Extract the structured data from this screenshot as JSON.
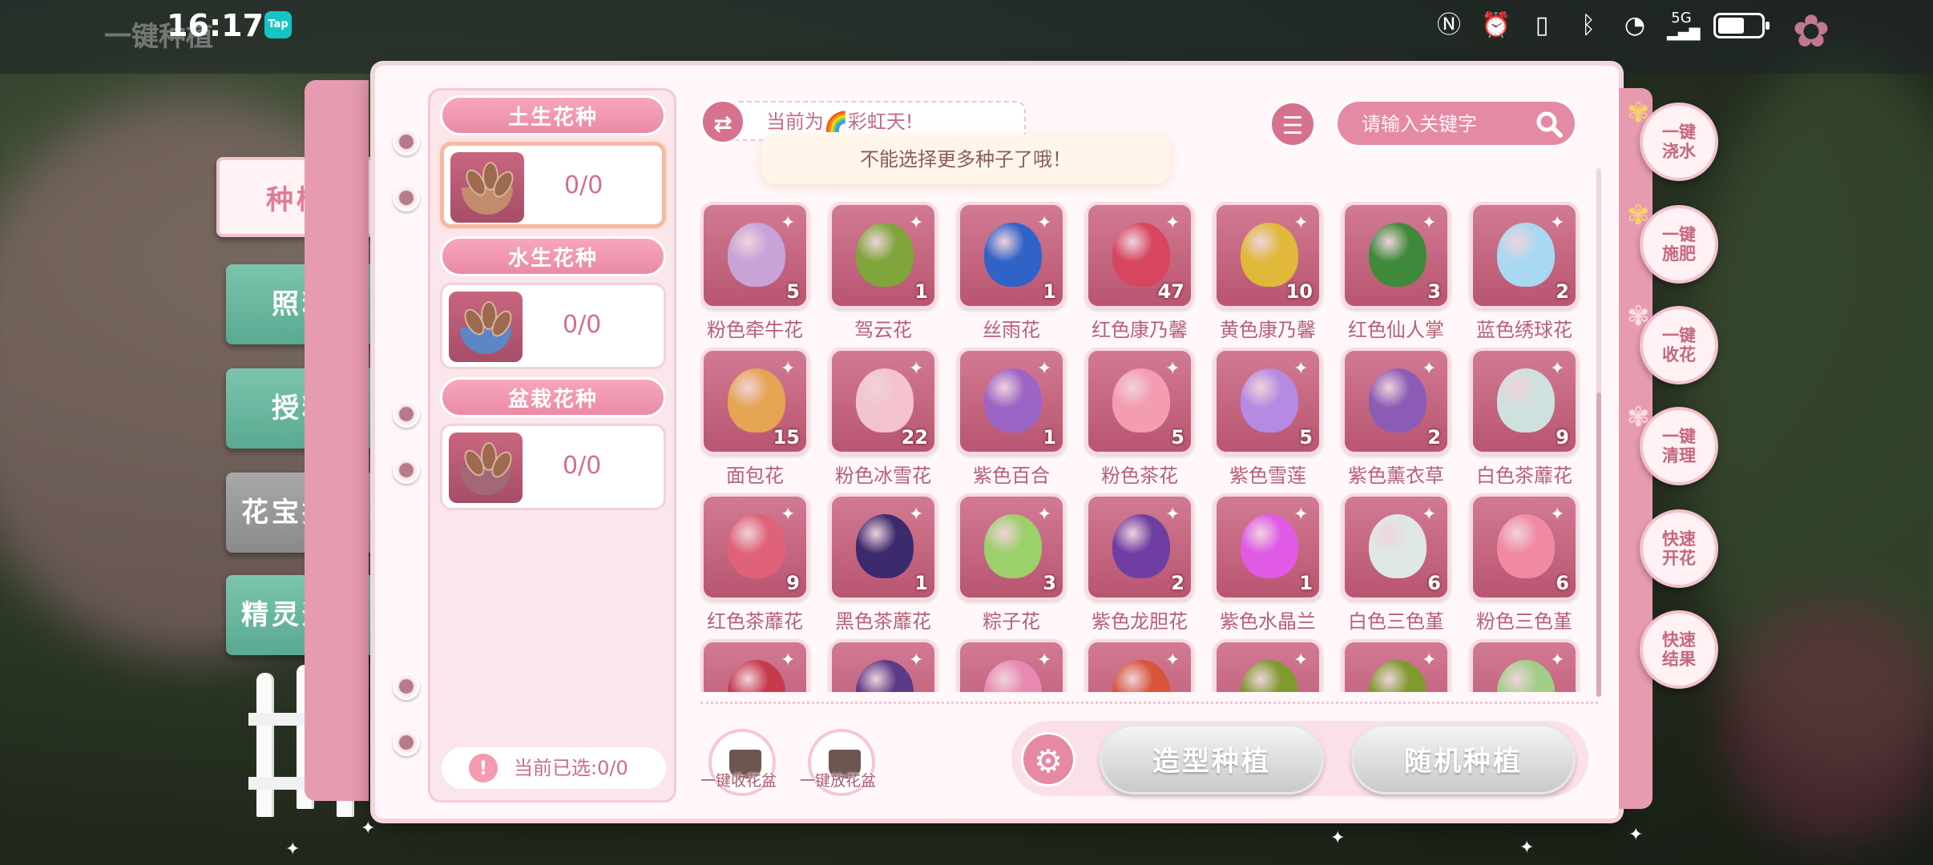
{
  "status_bar": {
    "bg_title": "一键种植",
    "time": "16:17",
    "tap_label": "Tap",
    "icons": [
      "nfc-icon",
      "alarm-icon",
      "vibrate-icon",
      "bluetooth-icon",
      "wifi-icon",
      "signal-5g-icon",
      "battery-icon"
    ],
    "signal_label": "5G"
  },
  "left_tabs": [
    {
      "label": "种植",
      "active": true
    },
    {
      "label": "照料"
    },
    {
      "label": "授粉"
    },
    {
      "label": "花宝技能"
    },
    {
      "label": "精灵道具"
    }
  ],
  "categories": [
    {
      "header": "土生花种",
      "count": "0/0",
      "type": "soil"
    },
    {
      "header": "水生花种",
      "count": "0/0",
      "type": "water"
    },
    {
      "header": "盆栽花种",
      "count": "0/0",
      "type": "pot"
    }
  ],
  "selected_label": "当前已选:0/0",
  "weather": {
    "prefix": "当前为",
    "emoji": "🌈",
    "name": "彩虹天!"
  },
  "toast": "不能选择更多种子了哦！",
  "search": {
    "placeholder": "请输入关键字"
  },
  "items": [
    {
      "name": "粉色牵牛花",
      "count": "5",
      "color": "#c7a3d8"
    },
    {
      "name": "驾云花",
      "count": "1",
      "color": "#7ea53a"
    },
    {
      "name": "丝雨花",
      "count": "1",
      "color": "#2f63c8"
    },
    {
      "name": "红色康乃馨",
      "count": "47",
      "color": "#d7455e"
    },
    {
      "name": "黄色康乃馨",
      "count": "10",
      "color": "#e0b93b"
    },
    {
      "name": "红色仙人掌",
      "count": "3",
      "color": "#3f8a3a"
    },
    {
      "name": "蓝色绣球花",
      "count": "2",
      "color": "#a9d8f2"
    },
    {
      "name": "面包花",
      "count": "15",
      "color": "#e5a552"
    },
    {
      "name": "粉色冰雪花",
      "count": "22",
      "color": "#f3c3cf"
    },
    {
      "name": "紫色百合",
      "count": "1",
      "color": "#9c64c6"
    },
    {
      "name": "粉色茶花",
      "count": "5",
      "color": "#f49cb1"
    },
    {
      "name": "紫色雪莲",
      "count": "5",
      "color": "#b68ae3"
    },
    {
      "name": "紫色薰衣草",
      "count": "2",
      "color": "#8a5cb6"
    },
    {
      "name": "白色茶蘼花",
      "count": "9",
      "color": "#cfe1de"
    },
    {
      "name": "红色茶蘼花",
      "count": "9",
      "color": "#e06278"
    },
    {
      "name": "黑色茶蘼花",
      "count": "1",
      "color": "#3b2a6c"
    },
    {
      "name": "粽子花",
      "count": "3",
      "color": "#9bd06a"
    },
    {
      "name": "紫色龙胆花",
      "count": "2",
      "color": "#6f3ea3"
    },
    {
      "name": "紫色水晶兰",
      "count": "1",
      "color": "#e05ae6"
    },
    {
      "name": "白色三色堇",
      "count": "6",
      "color": "#dfe8e6"
    },
    {
      "name": "粉色三色堇",
      "count": "6",
      "color": "#f08aa3"
    },
    {
      "name": "",
      "count": "",
      "color": "#c53b4d"
    },
    {
      "name": "",
      "count": "",
      "color": "#5b3a86"
    },
    {
      "name": "",
      "count": "",
      "color": "#e889b2"
    },
    {
      "name": "",
      "count": "",
      "color": "#d8543b"
    },
    {
      "name": "",
      "count": "",
      "color": "#7f9a2e"
    },
    {
      "name": "",
      "count": "",
      "color": "#7f9a2e"
    },
    {
      "name": "",
      "count": "",
      "color": "#9fcf87"
    }
  ],
  "bottom": {
    "collect_pots": "一键收花盆",
    "place_pots": "一键放花盆",
    "styled_plant": "造型种植",
    "random_plant": "随机种植"
  },
  "quick_actions": [
    "一键浇水",
    "一键施肥",
    "一键收花",
    "一键清理",
    "快速开花",
    "快速结果"
  ]
}
